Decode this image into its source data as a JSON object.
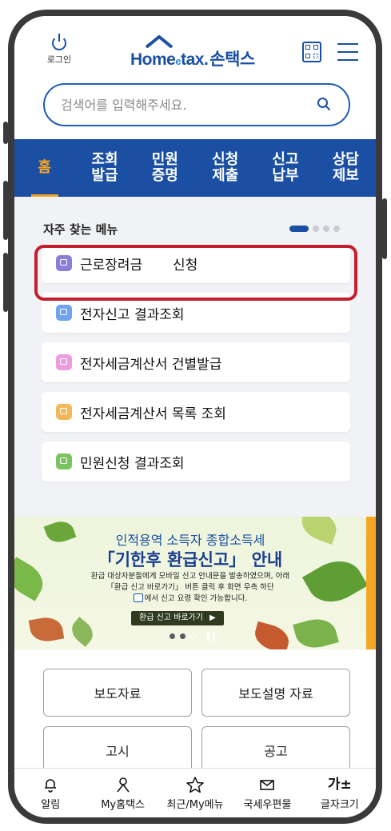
{
  "header": {
    "login_label": "로그인",
    "logo_home": "Home",
    "logo_e": "e",
    "logo_tax": "tax.",
    "logo_kr": "손택스"
  },
  "search": {
    "placeholder": "검색어를 입력해주세요."
  },
  "nav": {
    "tabs": [
      {
        "label": "홈",
        "active": true
      },
      {
        "label": "조회\n발급"
      },
      {
        "label": "민원\n증명"
      },
      {
        "label": "신청\n제출"
      },
      {
        "label": "신고\n납부"
      },
      {
        "label": "상담\n제보"
      }
    ]
  },
  "frequent": {
    "title": "자주 찾는 메뉴",
    "items": [
      {
        "label": "근로장려금       신청",
        "icon": "document-icon",
        "icon_color": "#8a7fd8"
      },
      {
        "label": "전자신고 결과조회",
        "icon": "document-icon",
        "icon_color": "#6fa3ee"
      },
      {
        "label": "전자세금계산서 건별발급",
        "icon": "monitor-icon",
        "icon_color": "#ec9de0"
      },
      {
        "label": "전자세금계산서 목록 조회",
        "icon": "monitor-icon",
        "icon_color": "#f3b85c"
      },
      {
        "label": "민원신청 결과조회",
        "icon": "monitor-icon",
        "icon_color": "#7cc45f"
      }
    ],
    "pager_total": 4,
    "pager_active": 1
  },
  "banner": {
    "line1": "인적용역 소득자 종합소득세",
    "line2": "「기한후 환급신고」 안내",
    "line3": "환급 대상자분들에게 모바일 신고 안내문을 발송하였으며, 아래",
    "line4": "「환급 신고 바로가기」 버튼 클릭 후 화면 우측 하단",
    "line5": "에서 신고 요령 확인 가능합니다.",
    "cta": "환급 신고 바로가기",
    "accent_color": "#f5a623"
  },
  "press": {
    "buttons": [
      "보도자료",
      "보도설명 자료",
      "고시",
      "공고"
    ]
  },
  "bottom_bar": {
    "items": [
      {
        "label": "알림",
        "icon": "bell-icon"
      },
      {
        "label": "My홈택스",
        "icon": "person-icon"
      },
      {
        "label": "최근/My메뉴",
        "icon": "star-icon"
      },
      {
        "label": "국세우편물",
        "icon": "mail-icon"
      },
      {
        "label": "글자크기",
        "icon": "text-size-icon",
        "glyph": "가±"
      }
    ]
  },
  "colors": {
    "brand": "#1a4fa3",
    "active_tab": "#f5a623",
    "highlight": "#c2202e"
  }
}
